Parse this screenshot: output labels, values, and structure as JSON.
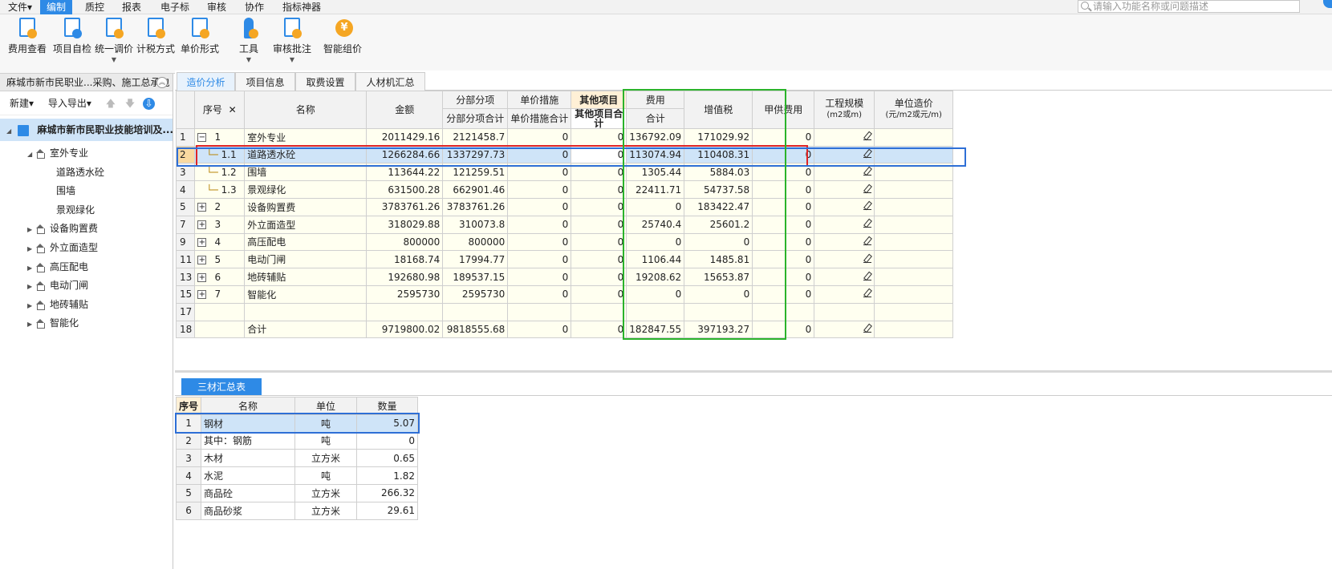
{
  "menu": {
    "items": [
      "文件▾",
      "编制",
      "质控",
      "报表",
      "电子标",
      "审核",
      "协作",
      "指标神器"
    ],
    "active_index": 1,
    "search_placeholder": "请输入功能名称或问题描述"
  },
  "ribbon": {
    "buttons": [
      {
        "label": "费用查看",
        "icon": "fee-view-icon"
      },
      {
        "label": "项目自检",
        "icon": "self-check-icon"
      },
      {
        "label": "统一调价",
        "icon": "price-adjust-icon",
        "dropdown": true
      },
      {
        "label": "计税方式",
        "icon": "tax-method-icon"
      },
      {
        "label": "单价形式",
        "icon": "unit-price-icon"
      },
      {
        "label": "工具",
        "icon": "tools-icon",
        "dropdown": true
      },
      {
        "label": "审核批注",
        "icon": "review-icon",
        "dropdown": true
      },
      {
        "label": "智能组价",
        "icon": "smart-pricing-icon"
      }
    ]
  },
  "left_pane": {
    "header": "麻城市新市民职业...采购、施工总承包",
    "tools": {
      "new": "新建▾",
      "import_export": "导入导出▾",
      "up": "🡅",
      "down": "🡇"
    },
    "tree_root": "麻城市新市民职业技能培训及...",
    "tree": [
      {
        "label": "室外专业",
        "level": 1,
        "expanded": true
      },
      {
        "label": "道路透水砼",
        "level": 2
      },
      {
        "label": "围墙",
        "level": 2
      },
      {
        "label": "景观绿化",
        "level": 2
      },
      {
        "label": "设备购置费",
        "level": 1,
        "expanded": false
      },
      {
        "label": "外立面造型",
        "level": 1,
        "expanded": false
      },
      {
        "label": "高压配电",
        "level": 1,
        "expanded": false
      },
      {
        "label": "电动门闸",
        "level": 1,
        "expanded": false
      },
      {
        "label": "地砖辅贴",
        "level": 1,
        "expanded": false
      },
      {
        "label": "智能化",
        "level": 1,
        "expanded": false
      }
    ]
  },
  "tabs": [
    "造价分析",
    "项目信息",
    "取费设置",
    "人材机汇总"
  ],
  "active_tab": 0,
  "grid": {
    "headers": {
      "seq": "序号",
      "close": "✕",
      "name": "名称",
      "amount": "金额",
      "fbfx": "分部分项",
      "fbfx_total": "分部分项合计",
      "djcs": "单价措施",
      "djcs_total": "单价措施合计",
      "other": "其他项目",
      "other_total": "其他项目合计",
      "fee": "费用",
      "fee_total": "合计",
      "vat": "增值税",
      "jgfy": "甲供费用",
      "scale": "工程规模",
      "scale_unit": "(m2或m)",
      "unit_cost": "单位造价",
      "unit_cost_unit": "(元/m2或元/m)"
    },
    "rows": [
      {
        "rn": "1",
        "toggle": "−",
        "seq": "1",
        "name": "室外专业",
        "amount": "2011429.16",
        "fbfx": "2121458.7",
        "djcs": "0",
        "other": "0",
        "fee": "136792.09",
        "vat": "171029.92",
        "jg": "0",
        "edit": true
      },
      {
        "rn": "2",
        "seq": "1.1",
        "name": "道路透水砼",
        "amount": "1266284.66",
        "fbfx": "1337297.73",
        "djcs": "0",
        "other": "0",
        "fee": "113074.94",
        "vat": "110408.31",
        "jg": "0",
        "edit": true,
        "selected": true
      },
      {
        "rn": "3",
        "seq": "1.2",
        "name": "围墙",
        "amount": "113644.22",
        "fbfx": "121259.51",
        "djcs": "0",
        "other": "0",
        "fee": "1305.44",
        "vat": "5884.03",
        "jg": "0",
        "edit": true
      },
      {
        "rn": "4",
        "seq": "1.3",
        "name": "景观绿化",
        "amount": "631500.28",
        "fbfx": "662901.46",
        "djcs": "0",
        "other": "0",
        "fee": "22411.71",
        "vat": "54737.58",
        "jg": "0",
        "edit": true
      },
      {
        "rn": "5",
        "toggle": "+",
        "seq": "2",
        "name": "设备购置费",
        "amount": "3783761.26",
        "fbfx": "3783761.26",
        "djcs": "0",
        "other": "0",
        "fee": "0",
        "vat": "183422.47",
        "jg": "0",
        "edit": true
      },
      {
        "rn": "7",
        "toggle": "+",
        "seq": "3",
        "name": "外立面造型",
        "amount": "318029.88",
        "fbfx": "310073.8",
        "djcs": "0",
        "other": "0",
        "fee": "25740.4",
        "vat": "25601.2",
        "jg": "0",
        "edit": true
      },
      {
        "rn": "9",
        "toggle": "+",
        "seq": "4",
        "name": "高压配电",
        "amount": "800000",
        "fbfx": "800000",
        "djcs": "0",
        "other": "0",
        "fee": "0",
        "vat": "0",
        "jg": "0",
        "edit": true
      },
      {
        "rn": "11",
        "toggle": "+",
        "seq": "5",
        "name": "电动门闸",
        "amount": "18168.74",
        "fbfx": "17994.77",
        "djcs": "0",
        "other": "0",
        "fee": "1106.44",
        "vat": "1485.81",
        "jg": "0",
        "edit": true
      },
      {
        "rn": "13",
        "toggle": "+",
        "seq": "6",
        "name": "地砖辅贴",
        "amount": "192680.98",
        "fbfx": "189537.15",
        "djcs": "0",
        "other": "0",
        "fee": "19208.62",
        "vat": "15653.87",
        "jg": "0",
        "edit": true
      },
      {
        "rn": "15",
        "toggle": "+",
        "seq": "7",
        "name": "智能化",
        "amount": "2595730",
        "fbfx": "2595730",
        "djcs": "0",
        "other": "0",
        "fee": "0",
        "vat": "0",
        "jg": "0",
        "edit": true
      },
      {
        "rn": "17",
        "seq": "",
        "name": "",
        "amount": "",
        "fbfx": "",
        "djcs": "",
        "other": "",
        "fee": "",
        "vat": "",
        "jg": "",
        "edit": false
      },
      {
        "rn": "18",
        "seq": "",
        "name": "合计",
        "amount": "9719800.02",
        "fbfx": "9818555.68",
        "djcs": "0",
        "other": "0",
        "fee": "182847.55",
        "vat": "397193.27",
        "jg": "0",
        "edit": true
      }
    ]
  },
  "bottom": {
    "tab": "三材汇总表",
    "headers": {
      "seq": "序号",
      "name": "名称",
      "unit": "单位",
      "qty": "数量"
    },
    "rows": [
      {
        "rn": "1",
        "name": "钢材",
        "unit": "吨",
        "qty": "5.07",
        "selected": true
      },
      {
        "rn": "2",
        "name": "其中：钢筋",
        "unit": "吨",
        "qty": "0"
      },
      {
        "rn": "3",
        "name": "木材",
        "unit": "立方米",
        "qty": "0.65"
      },
      {
        "rn": "4",
        "name": "水泥",
        "unit": "吨",
        "qty": "1.82"
      },
      {
        "rn": "5",
        "name": "商品砼",
        "unit": "立方米",
        "qty": "266.32"
      },
      {
        "rn": "6",
        "name": "商品砂浆",
        "unit": "立方米",
        "qty": "29.61"
      }
    ]
  },
  "colors": {
    "accent": "#2e8ae6",
    "selected_row": "#cfe4f8",
    "cell_bg": "#fffff0",
    "red_annotation": "#e02424",
    "green_annotation": "#2bb32b"
  }
}
